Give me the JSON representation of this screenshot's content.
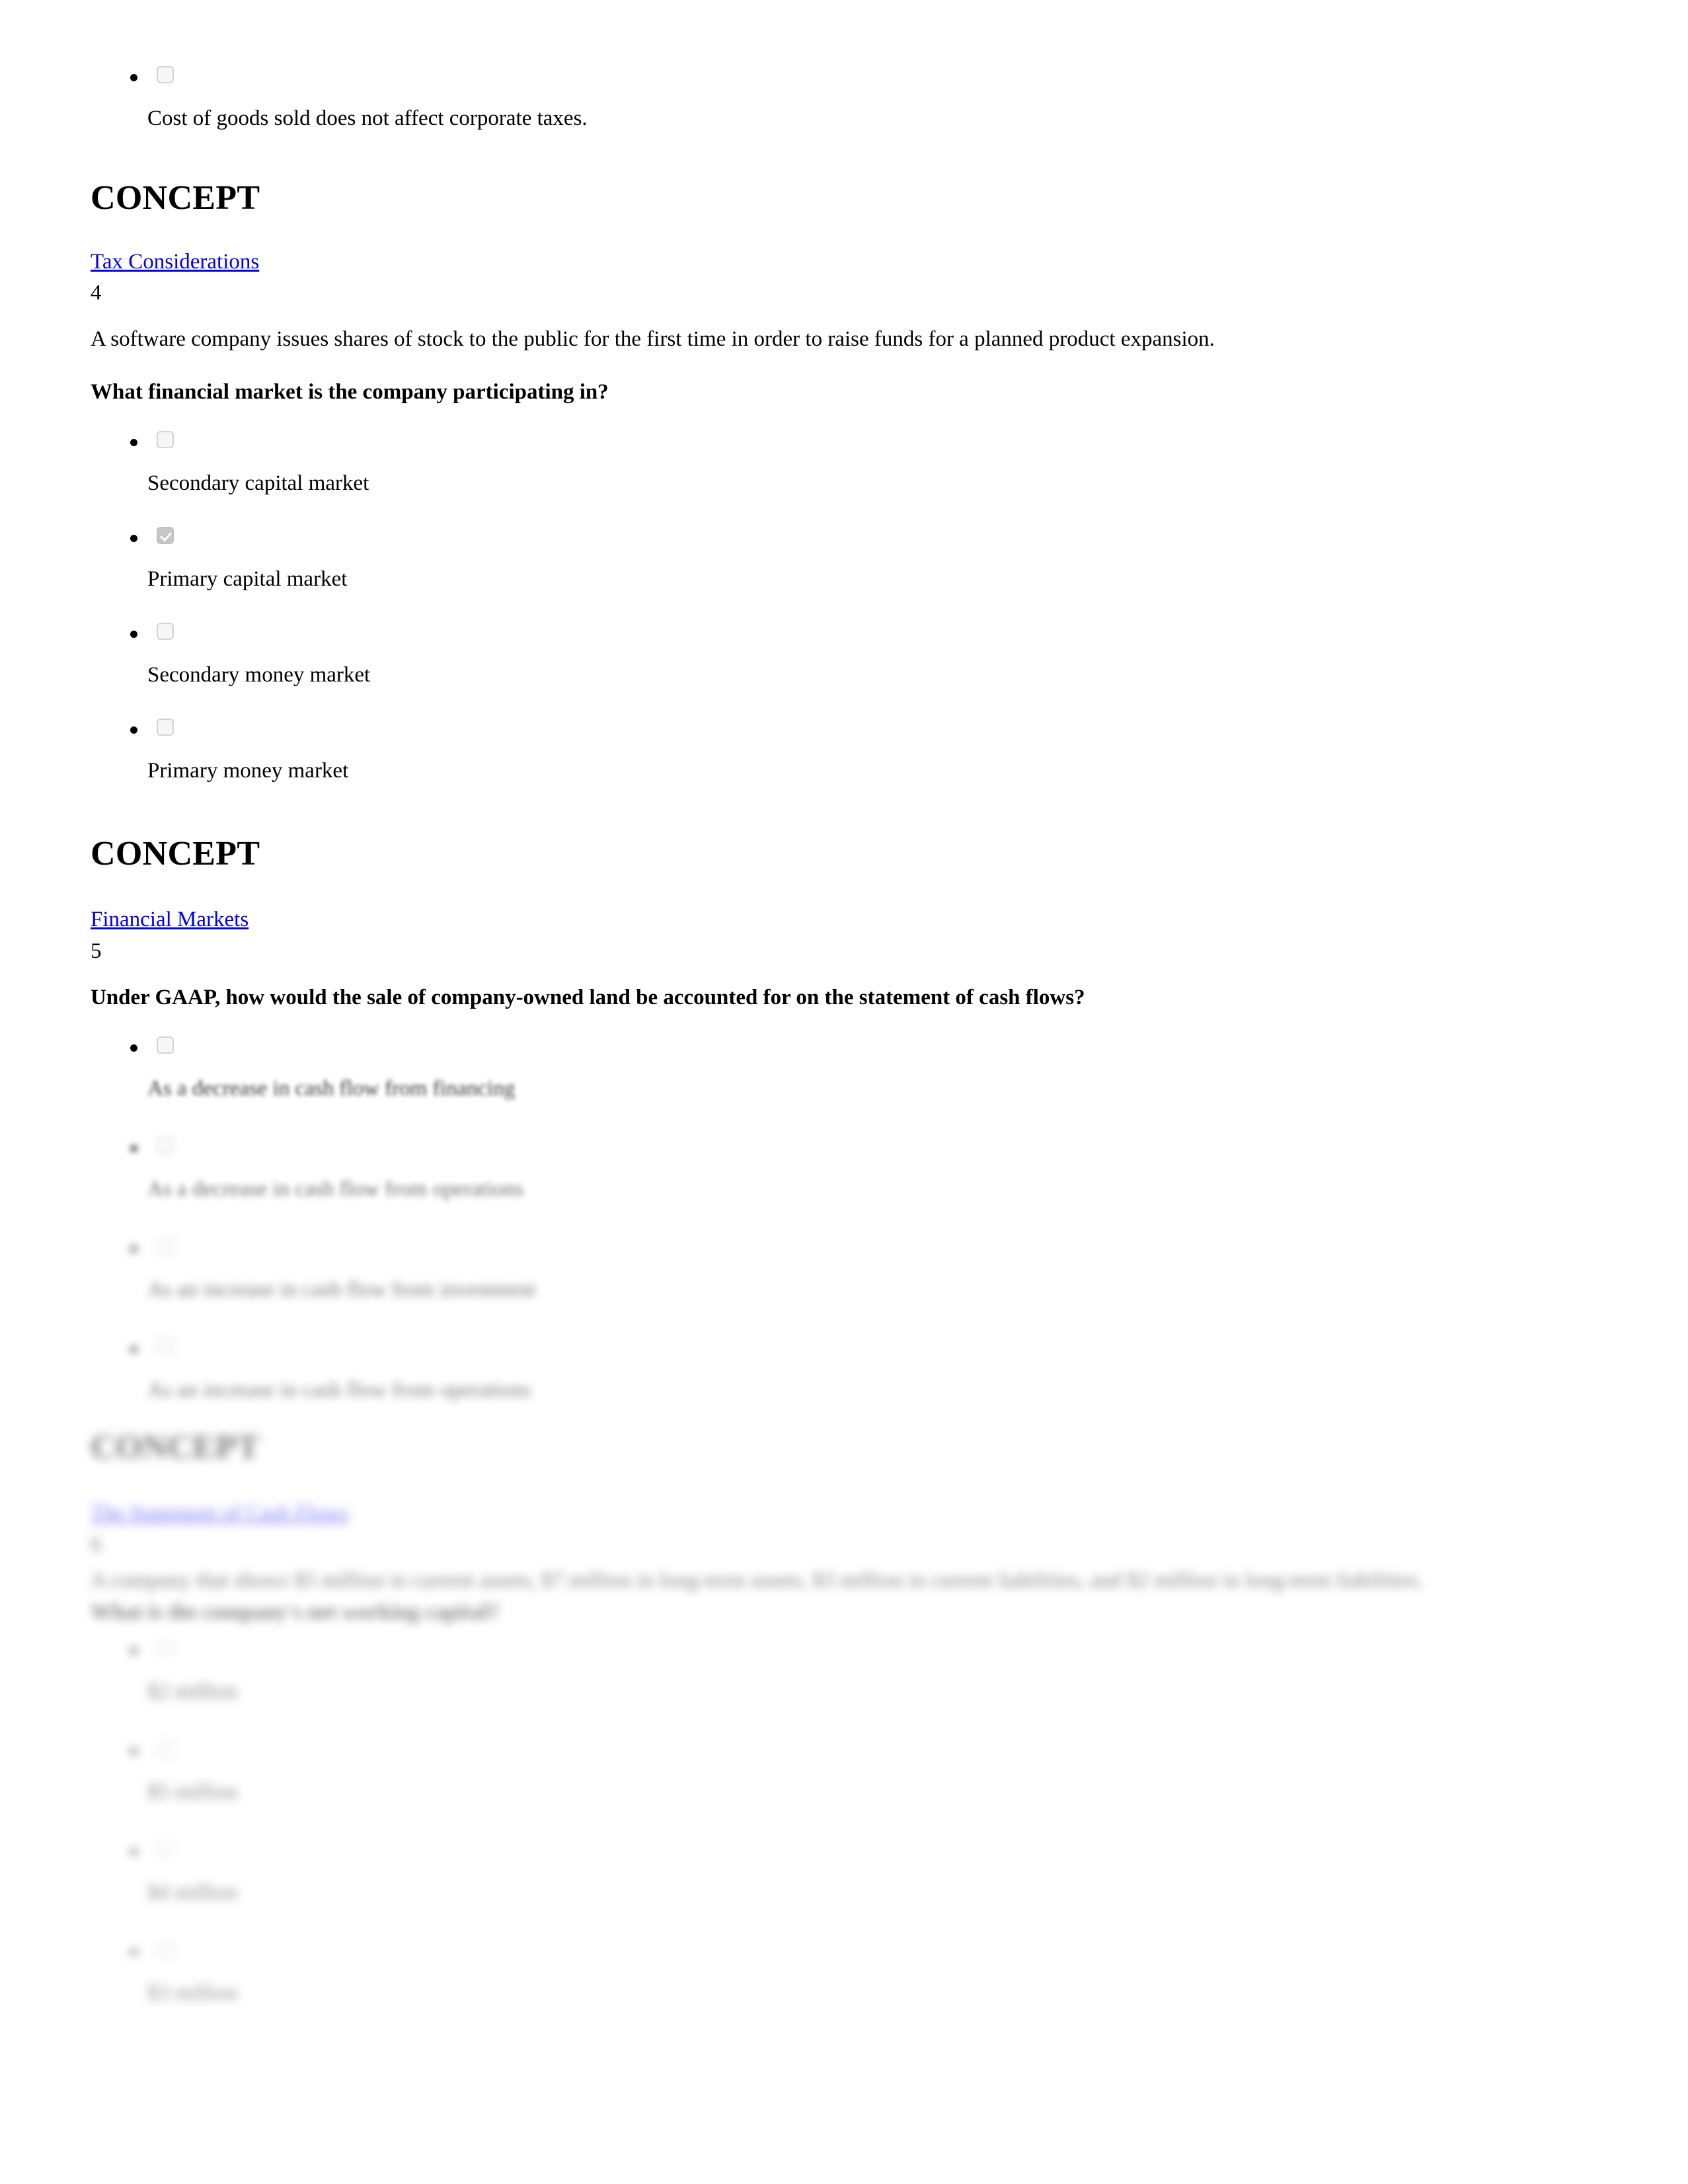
{
  "document": {
    "type": "quiz-review-printout",
    "link_color": "#0000ee",
    "text_color": "#000000",
    "background": "#ffffff"
  },
  "top_partial_option": {
    "label": "Cost of goods sold does not affect corporate taxes.",
    "checked": false
  },
  "concept_blocks": [
    {
      "heading": "CONCEPT",
      "link": "Tax Considerations"
    },
    {
      "heading": "CONCEPT",
      "link": "Financial Markets"
    },
    {
      "heading": "CONCEPT",
      "link": "The Statement of Cash Flows"
    }
  ],
  "questions": [
    {
      "number": "4",
      "stem": "A software company issues shares of stock to the public for the first time in order to raise funds for a planned product expansion.",
      "prompt": "What financial market is the company participating in?",
      "options": [
        {
          "label": "Secondary capital market",
          "checked": false
        },
        {
          "label": "Primary capital market",
          "checked": true
        },
        {
          "label": "Secondary money market",
          "checked": false
        },
        {
          "label": "Primary money market",
          "checked": false
        }
      ]
    },
    {
      "number": "5",
      "stem": "",
      "prompt": "Under GAAP, how would the sale of company-owned land be accounted for on the statement of cash flows?",
      "options": [
        {
          "label": "As a decrease in cash flow from financing",
          "checked": false
        },
        {
          "label": "As a decrease in cash flow from operations",
          "checked": false
        },
        {
          "label": "As an increase in cash flow from investment",
          "checked": false
        },
        {
          "label": "As an increase in cash flow from operations",
          "checked": false
        }
      ]
    },
    {
      "number": "6",
      "stem": "A company that shows $5 million in current assets, $7 million in long-term assets, $3 million in current liabilities, and $2 million in long-term liabilities.",
      "prompt": "What is the company's net working capital?",
      "options": [
        {
          "label": "$2 million",
          "checked": false
        },
        {
          "label": "$5 million",
          "checked": false
        },
        {
          "label": "$4 million",
          "checked": false
        },
        {
          "label": "$3 million",
          "checked": false
        }
      ]
    }
  ]
}
